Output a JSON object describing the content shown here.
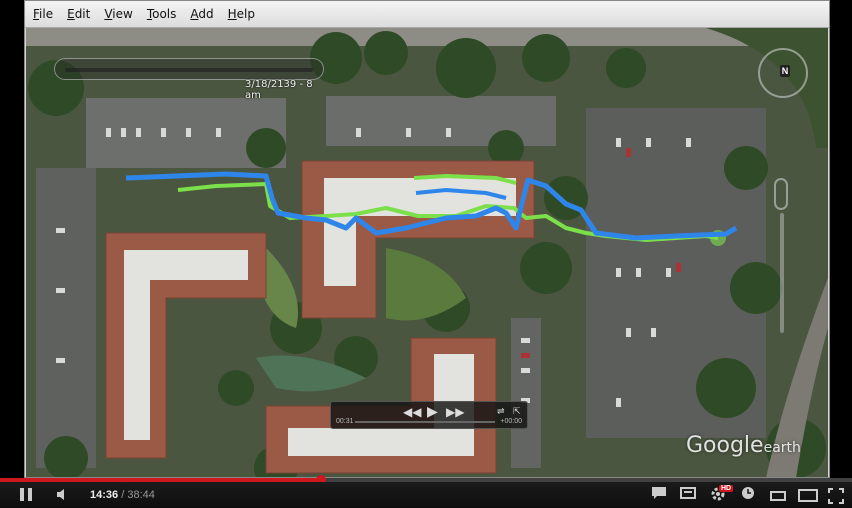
{
  "menu": {
    "items": [
      "File",
      "Edit",
      "View",
      "Tools",
      "Add",
      "Help"
    ]
  },
  "map": {
    "time_slider_label": "3/18/2139 - 8 am",
    "north_label": "N",
    "logo_word": "Google",
    "logo_suffix": "earth",
    "track_colors": {
      "blue": "#2f86ea",
      "green": "#7be04a"
    }
  },
  "tour": {
    "elapsed": "00:31",
    "remaining": "+00:00",
    "icons": [
      "rewind-icon",
      "play-icon",
      "fast-forward-icon",
      "settings-icon",
      "save-icon"
    ]
  },
  "player": {
    "current_time": "14:36",
    "separator": "/",
    "duration": "38:44",
    "progress_fraction": 0.377,
    "loaded_fraction": 0.38,
    "hd_badge": "HD",
    "accent_color": "#cc181e"
  }
}
